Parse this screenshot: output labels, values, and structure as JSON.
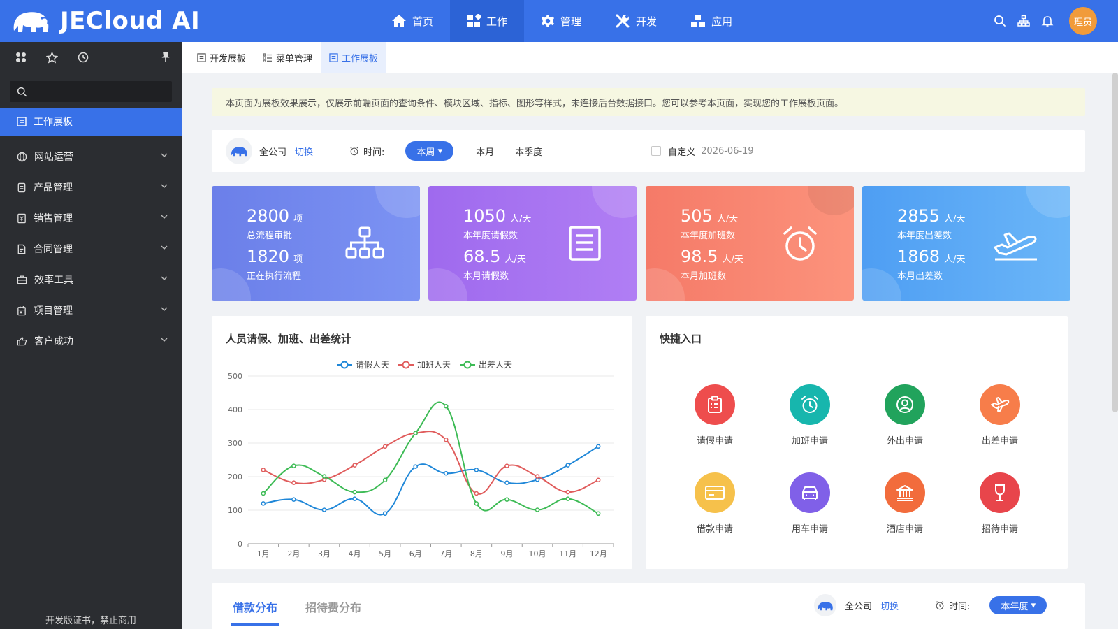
{
  "app": {
    "name": "JECloud AI",
    "avatar_text": "理员"
  },
  "topnav": [
    {
      "label": "首页",
      "icon": "home-icon"
    },
    {
      "label": "工作",
      "icon": "apps-icon",
      "active": true
    },
    {
      "label": "管理",
      "icon": "gear-icon"
    },
    {
      "label": "开发",
      "icon": "tools-icon"
    },
    {
      "label": "应用",
      "icon": "cubes-icon"
    }
  ],
  "sidebar": {
    "search_placeholder": "",
    "active_item": "工作展板",
    "items": [
      {
        "label": "网站运营",
        "icon": "globe-icon"
      },
      {
        "label": "产品管理",
        "icon": "box-icon"
      },
      {
        "label": "销售管理",
        "icon": "sales-icon"
      },
      {
        "label": "合同管理",
        "icon": "contract-icon"
      },
      {
        "label": "效率工具",
        "icon": "toolbox-icon"
      },
      {
        "label": "项目管理",
        "icon": "calendar-icon"
      },
      {
        "label": "客户成功",
        "icon": "thumbs-up-icon"
      }
    ],
    "footer": "开发版证书，禁止商用"
  },
  "tabs": [
    {
      "label": "开发展板"
    },
    {
      "label": "菜单管理"
    },
    {
      "label": "工作展板",
      "active": true
    }
  ],
  "notice": "本页面为展板效果展示，仅展示前端页面的查询条件、模块区域、指标、图形等样式，未连接后台数据接口。您可以参考本页面，实现您的工作展板页面。",
  "filter": {
    "company": "全公司",
    "switch_label": "切换",
    "time_label": "时间:",
    "selected": "本周",
    "options": [
      "本月",
      "本季度"
    ],
    "custom_label": "自定义",
    "custom_date": "2026-06-19"
  },
  "cards": [
    {
      "top_value": "2800",
      "top_unit": "项",
      "top_label": "总流程审批",
      "bottom_value": "1820",
      "bottom_unit": "项",
      "bottom_label": "正在执行流程",
      "icon": "org-chart-icon",
      "color": "#6f86f0"
    },
    {
      "top_value": "1050",
      "top_unit": "人/天",
      "top_label": "本年度请假数",
      "bottom_value": "68.5",
      "bottom_unit": "人/天",
      "bottom_label": "本月请假数",
      "icon": "document-icon",
      "color": "#a26ef0"
    },
    {
      "top_value": "505",
      "top_unit": "人/天",
      "top_label": "本年度加班数",
      "bottom_value": "98.5",
      "bottom_unit": "人/天",
      "bottom_label": "本月加班数",
      "icon": "alarm-clock-icon",
      "color": "#f97d6c"
    },
    {
      "top_value": "2855",
      "top_unit": "人/天",
      "top_label": "本年度出差数",
      "bottom_value": "1868",
      "bottom_unit": "人/天",
      "bottom_label": "本月出差数",
      "icon": "airplane-icon",
      "color": "#5aa8f5"
    }
  ],
  "chart_panel": {
    "title": "人员请假、加班、出差统计"
  },
  "chart_data": {
    "type": "line",
    "categories": [
      "1月",
      "2月",
      "3月",
      "4月",
      "5月",
      "6月",
      "7月",
      "8月",
      "9月",
      "10月",
      "11月",
      "12月"
    ],
    "series": [
      {
        "name": "请假人天",
        "color": "#1f87d8",
        "values": [
          120,
          132,
          101,
          134,
          90,
          230,
          210,
          220,
          182,
          191,
          234,
          290
        ]
      },
      {
        "name": "加班人天",
        "color": "#e05c5c",
        "values": [
          220,
          182,
          191,
          234,
          290,
          330,
          310,
          150,
          232,
          201,
          154,
          190
        ]
      },
      {
        "name": "出差人天",
        "color": "#3dbb55",
        "values": [
          150,
          232,
          201,
          154,
          190,
          330,
          410,
          120,
          132,
          101,
          134,
          90
        ]
      }
    ],
    "ylim": [
      0,
      500
    ],
    "yticks": [
      0,
      100,
      200,
      300,
      400,
      500
    ],
    "grid": true,
    "legend": "top-center"
  },
  "quick_entry": {
    "title": "快捷入口",
    "items": [
      {
        "label": "请假申请",
        "icon": "clipboard-icon",
        "color": "#ee4d4d"
      },
      {
        "label": "加班申请",
        "icon": "alarm-clock-icon",
        "color": "#17b6ad"
      },
      {
        "label": "外出申请",
        "icon": "user-circle-icon",
        "color": "#21a35c"
      },
      {
        "label": "出差申请",
        "icon": "airplane-icon",
        "color": "#f77d4a"
      },
      {
        "label": "借款申请",
        "icon": "card-icon",
        "color": "#f6c14b"
      },
      {
        "label": "用车申请",
        "icon": "car-icon",
        "color": "#8060e8"
      },
      {
        "label": "酒店申请",
        "icon": "bank-icon",
        "color": "#f26c3c"
      },
      {
        "label": "招待申请",
        "icon": "wine-glass-icon",
        "color": "#e8454b"
      }
    ]
  },
  "bottom_panel": {
    "tabs": [
      {
        "label": "借款分布",
        "active": true
      },
      {
        "label": "招待费分布"
      }
    ],
    "company": "全公司",
    "switch_label": "切换",
    "time_label": "时间:",
    "selected": "本年度"
  }
}
